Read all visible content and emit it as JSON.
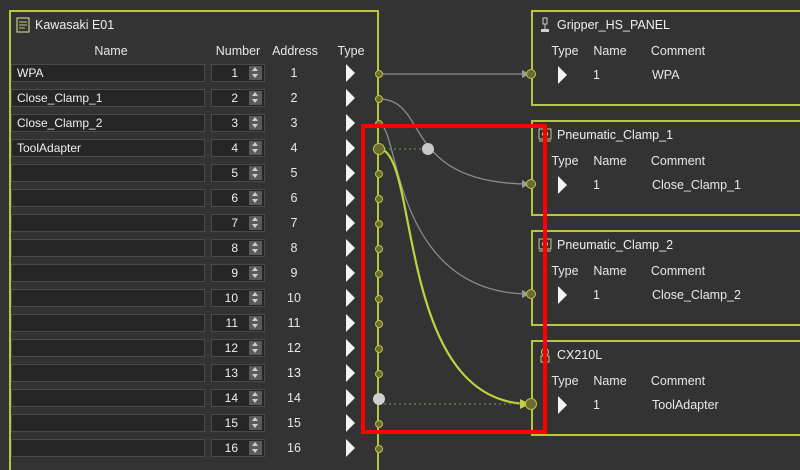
{
  "left_node": {
    "title": "Kawasaki E01",
    "icon": "controller-icon",
    "columns": {
      "name": "Name",
      "number": "Number",
      "address": "Address",
      "type": "Type"
    },
    "rows": [
      {
        "name": "WPA",
        "number": "1",
        "address": "1"
      },
      {
        "name": "Close_Clamp_1",
        "number": "2",
        "address": "2"
      },
      {
        "name": "Close_Clamp_2",
        "number": "3",
        "address": "3"
      },
      {
        "name": "ToolAdapter",
        "number": "4",
        "address": "4"
      },
      {
        "name": "",
        "number": "5",
        "address": "5"
      },
      {
        "name": "",
        "number": "6",
        "address": "6"
      },
      {
        "name": "",
        "number": "7",
        "address": "7"
      },
      {
        "name": "",
        "number": "8",
        "address": "8"
      },
      {
        "name": "",
        "number": "9",
        "address": "9"
      },
      {
        "name": "",
        "number": "10",
        "address": "10"
      },
      {
        "name": "",
        "number": "11",
        "address": "11"
      },
      {
        "name": "",
        "number": "12",
        "address": "12"
      },
      {
        "name": "",
        "number": "13",
        "address": "13"
      },
      {
        "name": "",
        "number": "14",
        "address": "14"
      },
      {
        "name": "",
        "number": "15",
        "address": "15"
      },
      {
        "name": "",
        "number": "16",
        "address": "16"
      }
    ]
  },
  "right_nodes": [
    {
      "title": "Gripper_HS_PANEL",
      "icon": "panel-icon",
      "columns": {
        "type": "Type",
        "name": "Name",
        "comment": "Comment"
      },
      "row": {
        "name": "1",
        "comment": "WPA"
      }
    },
    {
      "title": "Pneumatic_Clamp_1",
      "icon": "clamp-icon",
      "columns": {
        "type": "Type",
        "name": "Name",
        "comment": "Comment"
      },
      "row": {
        "name": "1",
        "comment": "Close_Clamp_1"
      }
    },
    {
      "title": "Pneumatic_Clamp_2",
      "icon": "clamp-icon",
      "columns": {
        "type": "Type",
        "name": "Name",
        "comment": "Comment"
      },
      "row": {
        "name": "1",
        "comment": "Close_Clamp_2"
      }
    },
    {
      "title": "CX210L",
      "icon": "tool-changer-icon",
      "columns": {
        "type": "Type",
        "name": "Name",
        "comment": "Comment"
      },
      "row": {
        "name": "1",
        "comment": "ToolAdapter"
      }
    }
  ],
  "colors": {
    "background": "#333333",
    "node_border": "#b8c63a",
    "active_wire": "#c2d23a",
    "inactive_wire": "#8a8a8a",
    "highlight": "#ff0000"
  }
}
